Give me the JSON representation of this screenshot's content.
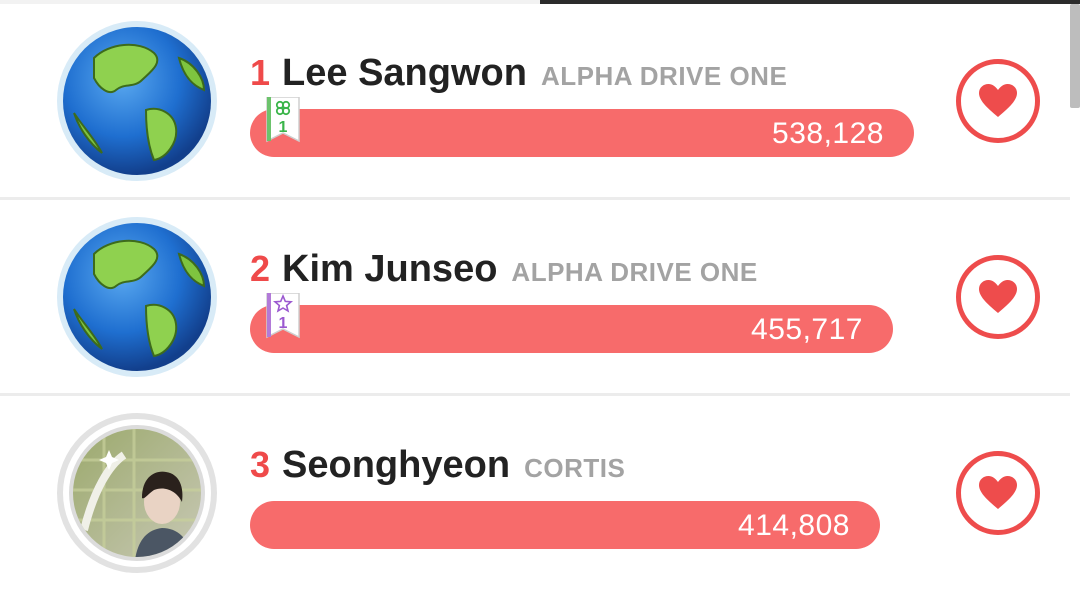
{
  "ranking": [
    {
      "rank": "1",
      "name": "Lee Sangwon",
      "group": "ALPHA DRIVE ONE",
      "votes": "538,128",
      "avatar": "globe-icon",
      "badge": {
        "icon": "clover-icon",
        "count": "1",
        "color": "#3bb54a"
      }
    },
    {
      "rank": "2",
      "name": "Kim Junseo",
      "group": "ALPHA DRIVE ONE",
      "votes": "455,717",
      "avatar": "globe-icon",
      "badge": {
        "icon": "star-icon",
        "count": "1",
        "color": "#9b59d0"
      }
    },
    {
      "rank": "3",
      "name": "Seonghyeon",
      "group": "CORTIS",
      "votes": "414,808",
      "avatar": "profile-photo"
    }
  ],
  "colors": {
    "accent": "#ef4a4a",
    "bar": "#f76b6b",
    "group_text": "#a3a3a3"
  },
  "icons": {
    "vote_button": "heart-icon"
  }
}
